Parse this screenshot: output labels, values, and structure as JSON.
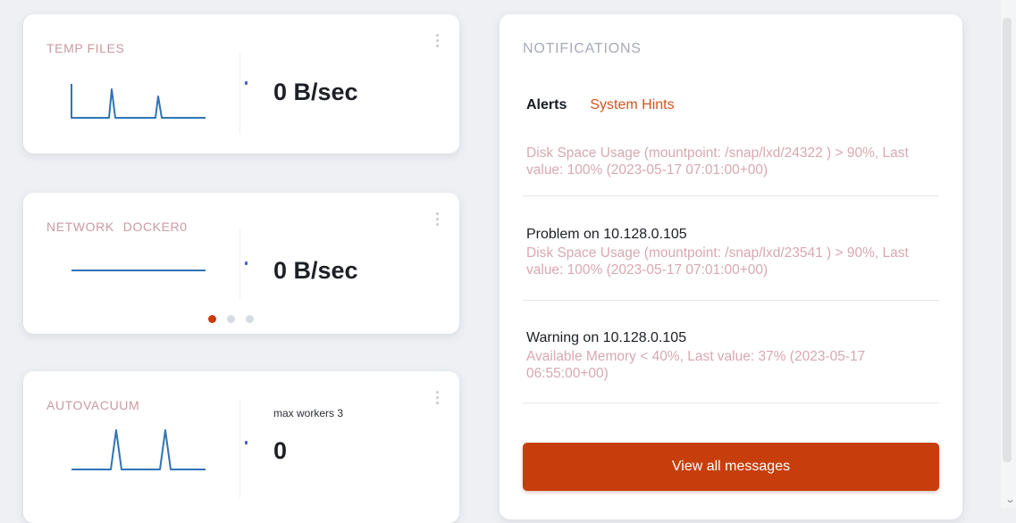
{
  "cards": [
    {
      "title": "TEMP FILES",
      "value": "0 B/sec",
      "icon": "kebab-menu-icon"
    },
    {
      "title_words": [
        "NETWORK",
        "DOCKER0"
      ],
      "value": "0 B/sec",
      "pagination": {
        "total": 3,
        "active_index": 0
      },
      "icon": "kebab-menu-icon"
    },
    {
      "title": "AUTOVACUUM",
      "sublabel": "max workers 3",
      "value": "0",
      "icon": "kebab-menu-icon"
    }
  ],
  "notifications": {
    "title": "NOTIFICATIONS",
    "tabs": [
      {
        "label": "Alerts",
        "active": true
      },
      {
        "label": "System Hints",
        "active": false
      }
    ],
    "messages": [
      {
        "heading": "",
        "body": "Disk Space Usage (mountpoint: /snap/lxd/24322 ) > 90%, Last value: 100% (2023-05-17 07:01:00+00)"
      },
      {
        "heading": "Problem on 10.128.0.105",
        "body": "Disk Space Usage (mountpoint: /snap/lxd/23541 ) > 90%, Last value: 100% (2023-05-17 07:01:00+00)"
      },
      {
        "heading": "Warning on 10.128.0.105",
        "body": "Available Memory < 40%, Last value: 37% (2023-05-17 06:55:00+00)"
      }
    ],
    "button_label": "View all messages"
  },
  "colors": {
    "accent": "#c73e0c",
    "hint_tab": "#cf5420",
    "sparkline": "#2f74b5",
    "muted_text": "#d7a8b1"
  }
}
